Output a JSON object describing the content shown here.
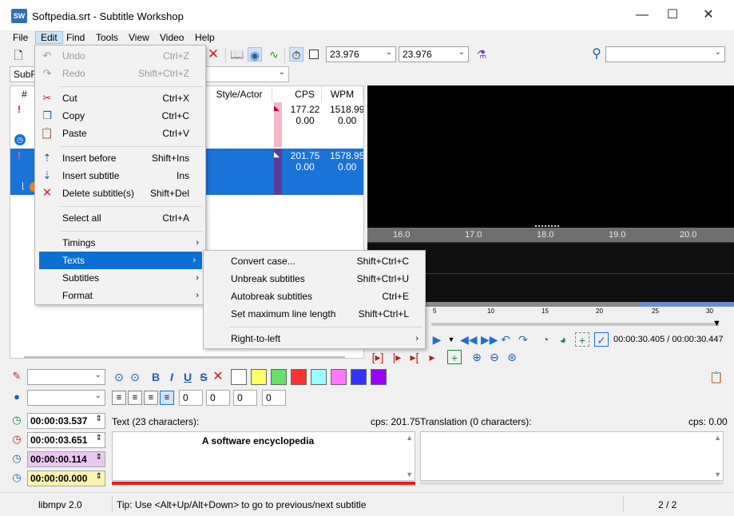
{
  "window": {
    "title": "Softpedia.srt - Subtitle Workshop",
    "icon_text": "SW",
    "minimize": "—",
    "maximize": "☐",
    "close": "✕"
  },
  "menubar": [
    "File",
    "Edit",
    "Find",
    "Tools",
    "View",
    "Video",
    "Help"
  ],
  "toolbar": {
    "fps1": "23.976",
    "fps2": "23.976",
    "search_value": "",
    "format_combo": "SubR"
  },
  "grid": {
    "headers": {
      "num": "#",
      "style": "Style/Actor",
      "cps": "CPS",
      "wpm": "WPM"
    },
    "rows": [
      {
        "cps": "177.22",
        "cps2": "0.00",
        "wpm": "1518.99",
        "wpm2": "0.00"
      },
      {
        "cps": "201.75",
        "cps2": "0.00",
        "wpm": "1578.95",
        "wpm2": "0.00"
      }
    ]
  },
  "timeline": {
    "ticks": [
      "16.0",
      "17.0",
      "18.0",
      "19.0",
      "20.0"
    ],
    "small_ticks": [
      "5",
      "10",
      "15",
      "20",
      "25",
      "30"
    ]
  },
  "playback": {
    "time": "00:00:30.405 / 00:00:30.447"
  },
  "edit_menu": {
    "items": [
      {
        "label": "Undo",
        "shortcut": "Ctrl+Z",
        "icon": "undo-icon",
        "disabled": true
      },
      {
        "label": "Redo",
        "shortcut": "Shift+Ctrl+Z",
        "icon": "redo-icon",
        "disabled": true
      },
      {
        "label": "Cut",
        "shortcut": "Ctrl+X",
        "icon": "scissors-icon"
      },
      {
        "label": "Copy",
        "shortcut": "Ctrl+C",
        "icon": "copy-icon"
      },
      {
        "label": "Paste",
        "shortcut": "Ctrl+V",
        "icon": "paste-icon"
      },
      {
        "label": "Insert before",
        "shortcut": "Shift+Ins",
        "icon": "insert-before-icon"
      },
      {
        "label": "Insert subtitle",
        "shortcut": "Ins",
        "icon": "insert-subtitle-icon"
      },
      {
        "label": "Delete subtitle(s)",
        "shortcut": "Shift+Del",
        "icon": "delete-icon"
      },
      {
        "label": "Select all",
        "shortcut": "Ctrl+A"
      },
      {
        "label": "Timings"
      },
      {
        "label": "Texts"
      },
      {
        "label": "Subtitles"
      },
      {
        "label": "Format"
      }
    ]
  },
  "texts_submenu": {
    "items": [
      {
        "label": "Convert case...",
        "shortcut": "Shift+Ctrl+C"
      },
      {
        "label": "Unbreak subtitles",
        "shortcut": "Shift+Ctrl+U"
      },
      {
        "label": "Autobreak subtitles",
        "shortcut": "Ctrl+E"
      },
      {
        "label": "Set maximum line length",
        "shortcut": "Shift+Ctrl+L"
      },
      {
        "label": "Right-to-left"
      }
    ]
  },
  "editor": {
    "style_combo": "",
    "actor_combo": "",
    "margins": [
      "0",
      "0",
      "0",
      "0"
    ],
    "show_time": "00:00:03.537",
    "hide_time": "00:00:03.651",
    "duration": "00:00:00.114",
    "pause": "00:00:00.000",
    "text_label": "Text (23 characters):",
    "text_cps": "cps: 201.75",
    "text_value": "A software encyclopedia",
    "translation_label": "Translation (0 characters):",
    "translation_cps": "cps: 0.00",
    "colors": [
      "#ffffff",
      "#ffff66",
      "#66e066",
      "#ff3333",
      "#99ffff",
      "#ff77ff",
      "#3333ff",
      "#9900ff"
    ]
  },
  "statusbar": {
    "engine": "libmpv 2.0",
    "tip": "Tip: Use <Alt+Up/Alt+Down> to go to previous/next subtitle",
    "position": "2 / 2"
  }
}
